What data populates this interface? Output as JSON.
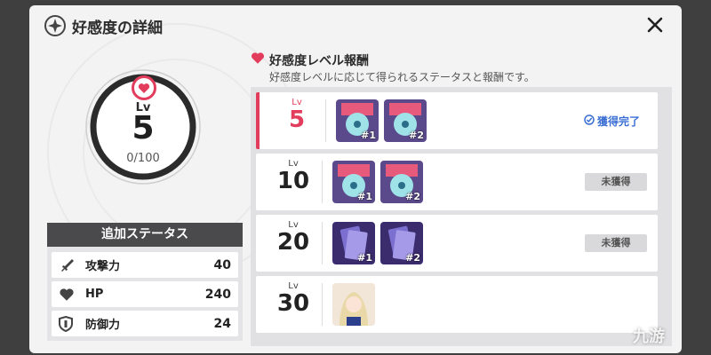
{
  "header": {
    "title": "好感度の詳細",
    "icon": "flower-emblem-icon",
    "close_icon": "close-icon"
  },
  "level": {
    "label": "Lv",
    "value": "5",
    "progress": "0/100",
    "icon": "heart-icon",
    "accent": "#e23d5c"
  },
  "status": {
    "title": "追加ステータス",
    "items": [
      {
        "icon": "sword-icon",
        "label": "攻撃力",
        "value": "40"
      },
      {
        "icon": "heart-icon",
        "label": "HP",
        "value": "240"
      },
      {
        "icon": "shield-icon",
        "label": "防御力",
        "value": "24"
      }
    ]
  },
  "rewards": {
    "title": "好感度レベル報酬",
    "description": "好感度レベルに応じて得られるステータスと報酬です。",
    "rows": [
      {
        "lv_label": "Lv",
        "level": "5",
        "items": [
          {
            "num": "#1",
            "kind": "disc"
          },
          {
            "num": "#2",
            "kind": "disc"
          }
        ],
        "status": "獲得完了",
        "claimed": true
      },
      {
        "lv_label": "Lv",
        "level": "10",
        "items": [
          {
            "num": "#1",
            "kind": "disc"
          },
          {
            "num": "#2",
            "kind": "disc"
          }
        ],
        "status": "未獲得",
        "claimed": false
      },
      {
        "lv_label": "Lv",
        "level": "20",
        "items": [
          {
            "num": "#1",
            "kind": "card"
          },
          {
            "num": "#2",
            "kind": "card"
          }
        ],
        "status": "未獲得",
        "claimed": false
      },
      {
        "lv_label": "Lv",
        "level": "30",
        "items": [
          {
            "num": "",
            "kind": "portrait"
          }
        ],
        "status": "",
        "claimed": false
      }
    ],
    "claimed_color": "#3b6fd4"
  },
  "watermark": "九游"
}
